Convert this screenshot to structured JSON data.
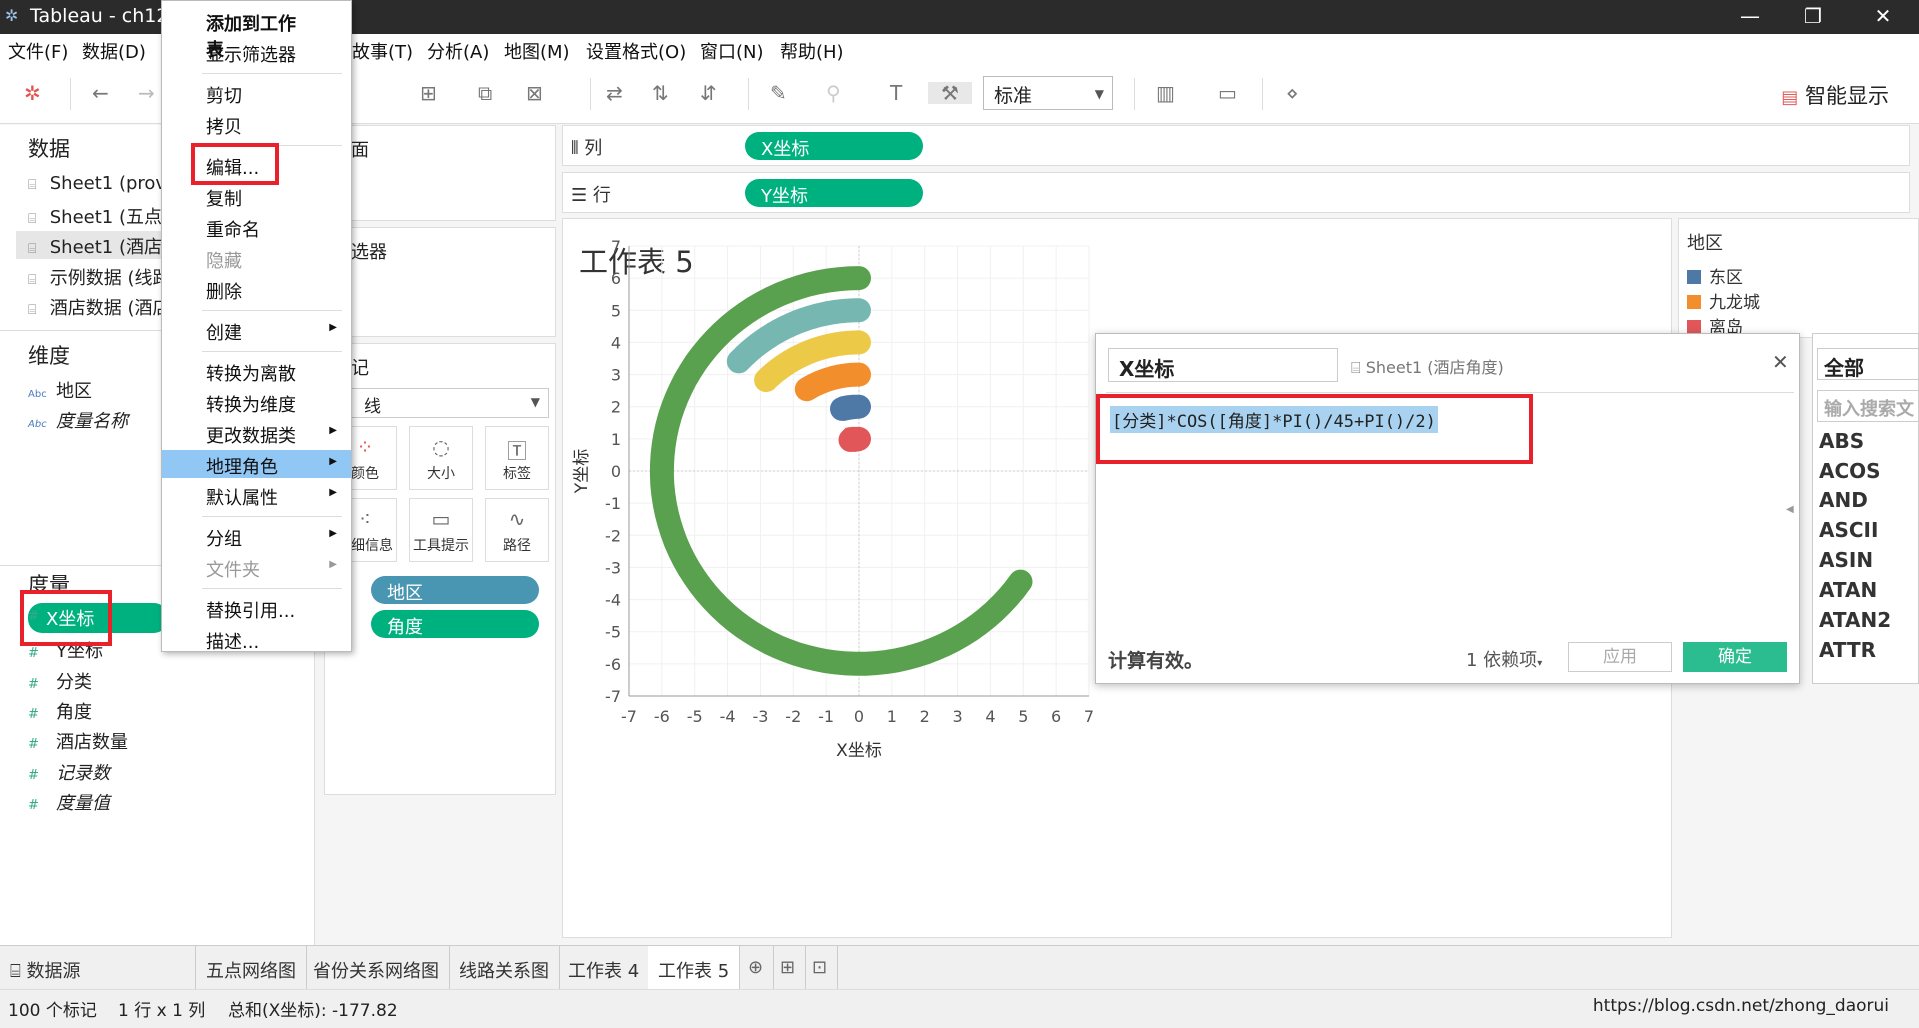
{
  "window": {
    "title": "Tableau - ch12",
    "minimize": "—",
    "maximize": "❐",
    "close": "✕"
  },
  "menu": [
    "文件(F)",
    "数据(D)",
    "故事(T)",
    "分析(A)",
    "地图(M)",
    "设置格式(O)",
    "窗口(N)",
    "帮助(H)"
  ],
  "toolbar": {
    "view_select": "标准",
    "smart_show": "智能显示"
  },
  "data_pane": {
    "title": "数据",
    "sources": [
      "Sheet1 (prov",
      "Sheet1 (五点",
      "Sheet1 (酒店",
      "示例数据 (线路",
      "酒店数据 (酒店"
    ]
  },
  "dimensions": {
    "title": "维度",
    "items": [
      "地区",
      "度量名称"
    ]
  },
  "measures": {
    "title": "度量",
    "items": [
      "X坐标",
      "Y坐标",
      "分类",
      "角度",
      "酒店数量",
      "记录数",
      "度量值"
    ]
  },
  "cards": {
    "pages": "页面",
    "filters": "筛选器",
    "marks": "标记",
    "mark_type": "线",
    "buttons": [
      "颜色",
      "大小",
      "标签",
      "详细信息",
      "工具提示",
      "路径"
    ],
    "pills": [
      "地区",
      "角度"
    ]
  },
  "shelves": {
    "columns_label": "列",
    "rows_label": "行",
    "columns_pill": "X坐标",
    "rows_pill": "Y坐标"
  },
  "viz": {
    "title": "工作表 5"
  },
  "chart_data": {
    "type": "line",
    "xlabel": "X坐标",
    "ylabel": "Y坐标",
    "xlim": [
      -7,
      7
    ],
    "ylim": [
      -7,
      7
    ],
    "x_ticks": [
      "-7",
      "-6",
      "-5",
      "-4",
      "-3",
      "-2",
      "-1",
      "0",
      "1",
      "2",
      "3",
      "4",
      "5",
      "6",
      "7"
    ],
    "y_ticks": [
      "7",
      "6",
      "5",
      "4",
      "3",
      "2",
      "1",
      "0",
      "-1",
      "-2",
      "-3",
      "-4",
      "-5",
      "-6",
      "-7"
    ],
    "series": [
      {
        "radius": 6,
        "start_deg": 90,
        "end_deg": 325,
        "color": "#59a14f"
      },
      {
        "radius": 5,
        "start_deg": 90,
        "end_deg": 137,
        "color": "#76b7b2"
      },
      {
        "radius": 4,
        "start_deg": 90,
        "end_deg": 135,
        "color": "#edc948"
      },
      {
        "radius": 3,
        "start_deg": 90,
        "end_deg": 122,
        "color": "#f28e2b"
      },
      {
        "radius": 2,
        "start_deg": 90,
        "end_deg": 105,
        "color": "#4e79a7"
      },
      {
        "radius": 1,
        "start_deg": 90,
        "end_deg": 105,
        "color": "#e15759"
      }
    ]
  },
  "legend": {
    "title": "地区",
    "items": [
      {
        "label": "东区",
        "color": "#4e79a7"
      },
      {
        "label": "九龙城",
        "color": "#f28e2b"
      },
      {
        "label": "离岛",
        "color": "#e15759"
      }
    ]
  },
  "calc_dialog": {
    "name": "X坐标",
    "source": "Sheet1 (酒店角度)",
    "formula": "[分类]*COS([角度]*PI()/45+PI()/2)",
    "status": "计算有效。",
    "dependencies": "1 依赖项",
    "apply": "应用",
    "ok": "确定"
  },
  "functions": {
    "filter": "全部",
    "search_placeholder": "输入搜索文",
    "list": [
      "ABS",
      "ACOS",
      "AND",
      "ASCII",
      "ASIN",
      "ATAN",
      "ATAN2",
      "ATTR"
    ]
  },
  "context_menu": {
    "items": [
      {
        "label": "添加到工作表",
        "bold": true
      },
      {
        "label": "显示筛选器"
      },
      {
        "sep": true
      },
      {
        "label": "剪切"
      },
      {
        "label": "拷贝"
      },
      {
        "sep": true
      },
      {
        "label": "编辑..."
      },
      {
        "label": "复制"
      },
      {
        "label": "重命名"
      },
      {
        "label": "隐藏",
        "disabled": true
      },
      {
        "label": "删除"
      },
      {
        "sep": true
      },
      {
        "label": "创建",
        "submenu": true
      },
      {
        "sep": true
      },
      {
        "label": "转换为离散"
      },
      {
        "label": "转换为维度"
      },
      {
        "label": "更改数据类型",
        "submenu": true
      },
      {
        "label": "地理角色",
        "submenu": true,
        "highlight": true
      },
      {
        "label": "默认属性",
        "submenu": true
      },
      {
        "sep": true
      },
      {
        "label": "分组",
        "submenu": true
      },
      {
        "label": "文件夹",
        "submenu": true,
        "disabled": true
      },
      {
        "sep": true
      },
      {
        "label": "替换引用..."
      },
      {
        "label": "描述..."
      }
    ]
  },
  "tabs": [
    "数据源",
    "五点网络图",
    "省份关系网络图",
    "线路关系图",
    "工作表 4",
    "工作表 5"
  ],
  "status": {
    "marks": "100 个标记",
    "rows_cols": "1 行 x 1 列",
    "sum": "总和(X坐标): -177.82",
    "watermark": "https://blog.csdn.net/zhong_daorui"
  }
}
